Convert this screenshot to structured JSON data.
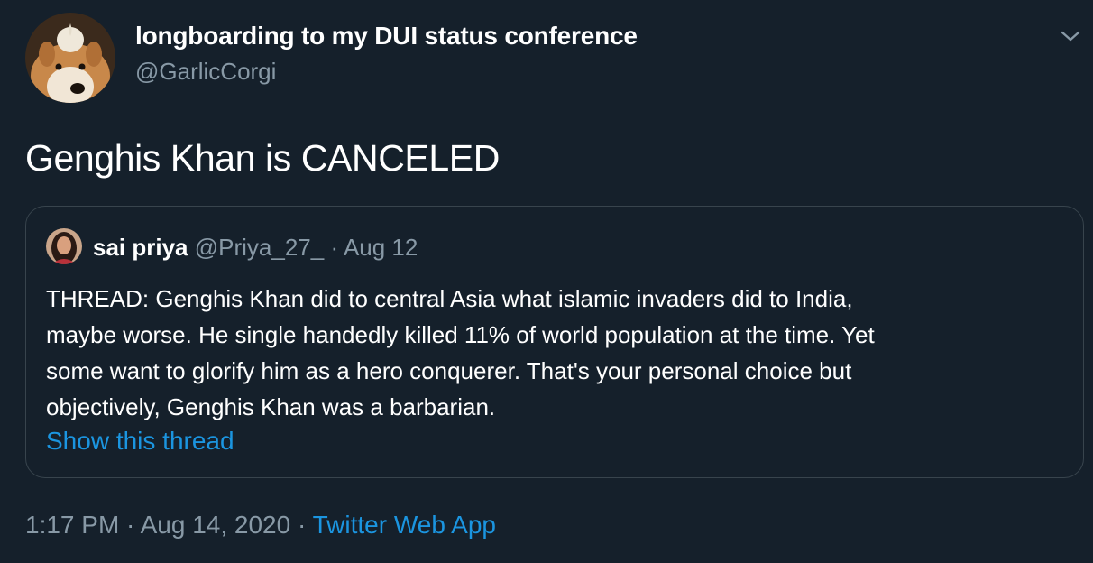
{
  "tweet": {
    "author": {
      "display_name": "longboarding to my DUI status conference",
      "handle": "@GarlicCorgi",
      "avatar_icon": "corgi-avatar-with-garlic"
    },
    "menu_icon": "chevron-down-icon",
    "text": "Genghis Khan is CANCELED",
    "quoted": {
      "display_name": "sai priya",
      "handle": "@Priya_27_",
      "separator": "·",
      "date": "Aug 12",
      "avatar_icon": "user-avatar",
      "lines": [
        "THREAD: Genghis Khan did to central Asia what islamic invaders did to India,",
        "maybe worse. He single handedly killed 11% of world population at the time. Yet",
        "some want to glorify him as a hero conquerer. That's your personal choice but",
        "objectively, Genghis Khan was a barbarian."
      ],
      "show_thread": "Show this thread"
    },
    "timestamp": "1:17 PM · Aug 14, 2020",
    "separator": "·",
    "source": "Twitter Web App"
  },
  "colors": {
    "background": "#15202b",
    "text": "#ffffff",
    "secondary": "#8899a6",
    "link": "#1b95e0",
    "border": "#38444d"
  }
}
